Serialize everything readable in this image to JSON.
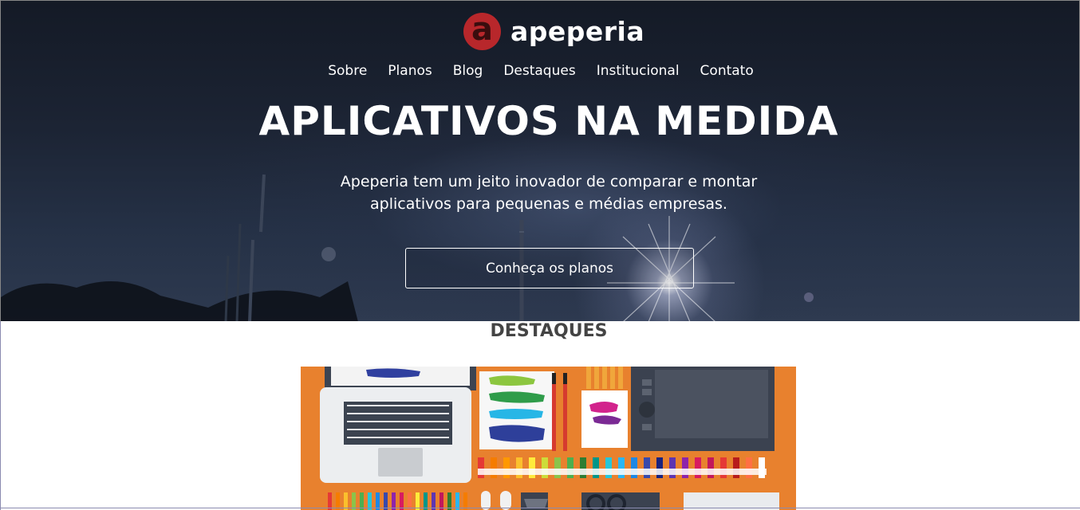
{
  "brand": {
    "logo_letter": "a",
    "name": "apeperia",
    "logo_color": "#b8272b"
  },
  "nav": {
    "items": [
      {
        "label": "Sobre"
      },
      {
        "label": "Planos"
      },
      {
        "label": "Blog"
      },
      {
        "label": "Destaques"
      },
      {
        "label": "Institucional"
      },
      {
        "label": "Contato"
      }
    ]
  },
  "hero": {
    "headline": "APLICATIVOS NA MEDIDA",
    "subtitle_line1": "Apeperia tem um jeito inovador de comparar e montar",
    "subtitle_line2": "aplicativos para pequenas e médias empresas.",
    "cta_label": "Conheça os planos"
  },
  "highlights": {
    "title": "DESTAQUES",
    "image_icon": "designer-desk-illustration",
    "accent_color": "#e8812e"
  }
}
